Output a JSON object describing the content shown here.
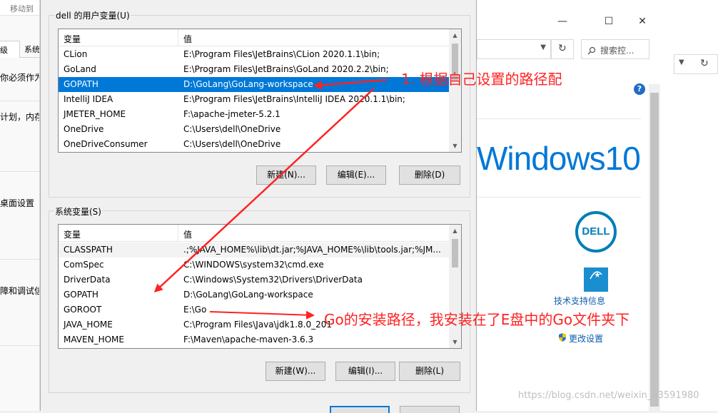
{
  "left_window": {
    "top_label": "移动到",
    "tab_active": "级",
    "tab_other": "系统",
    "lines": [
      "你必须作为",
      "计划，内存",
      "桌面设置",
      "障和调试信"
    ]
  },
  "right_window": {
    "minimize": "—",
    "maximize": "☐",
    "close": "✕",
    "refresh": "↻",
    "search_placeholder": "搜索控...",
    "help": "?",
    "os_logo": "Windows10",
    "brand_logo": "DELL",
    "energy_logo": "ENERGY STAR",
    "tech_support": "技术支持信息",
    "change_settings": "更改设置"
  },
  "user_vars": {
    "group_title": "dell 的用户变量(U)",
    "col_name": "变量",
    "col_value": "值",
    "rows": [
      {
        "name": "CLion",
        "value": "E:\\Program Files\\JetBrains\\CLion 2020.1.1\\bin;"
      },
      {
        "name": "GoLand",
        "value": "E:\\Program Files\\JetBrains\\GoLand 2020.2.2\\bin;"
      },
      {
        "name": "GOPATH",
        "value": "D:\\GoLang\\GoLang-workspace"
      },
      {
        "name": "IntelliJ IDEA",
        "value": "E:\\Program Files\\JetBrains\\IntelliJ IDEA 2020.1.1\\bin;"
      },
      {
        "name": "JMETER_HOME",
        "value": "F:\\apache-jmeter-5.2.1"
      },
      {
        "name": "OneDrive",
        "value": "C:\\Users\\dell\\OneDrive"
      },
      {
        "name": "OneDriveConsumer",
        "value": "C:\\Users\\dell\\OneDrive"
      }
    ],
    "new_button": "新建(N)...",
    "edit_button": "编辑(E)...",
    "delete_button": "删除(D)"
  },
  "system_vars": {
    "group_title": "系统变量(S)",
    "col_name": "变量",
    "col_value": "值",
    "rows": [
      {
        "name": "CLASSPATH",
        "value": ".;%JAVA_HOME%\\lib\\dt.jar;%JAVA_HOME%\\lib\\tools.jar;%JM..."
      },
      {
        "name": "ComSpec",
        "value": "C:\\WINDOWS\\system32\\cmd.exe"
      },
      {
        "name": "DriverData",
        "value": "C:\\Windows\\System32\\Drivers\\DriverData"
      },
      {
        "name": "GOPATH",
        "value": "D:\\GoLang\\GoLang-workspace"
      },
      {
        "name": "GOROOT",
        "value": "E:\\Go"
      },
      {
        "name": "JAVA_HOME",
        "value": "C:\\Program Files\\Java\\jdk1.8.0_201"
      },
      {
        "name": "MAVEN_HOME",
        "value": "F:\\Maven\\apache-maven-3.6.3"
      }
    ],
    "new_button": "新建(W)...",
    "edit_button": "编辑(I)...",
    "delete_button": "删除(L)"
  },
  "scroll_arrows": {
    "up": "▲",
    "down": "▼"
  },
  "annotations": {
    "note1": "1. 根据自己设置的路径配",
    "note2": "Go的安装路径，我安装在了E盘中的Go文件夹下"
  },
  "watermark": "https://blog.csdn.net/weixin_43591980",
  "colors": {
    "selection": "#0078d7",
    "annotation": "#ff2222",
    "windows_blue": "#0078d7",
    "dell_blue": "#007db8"
  }
}
